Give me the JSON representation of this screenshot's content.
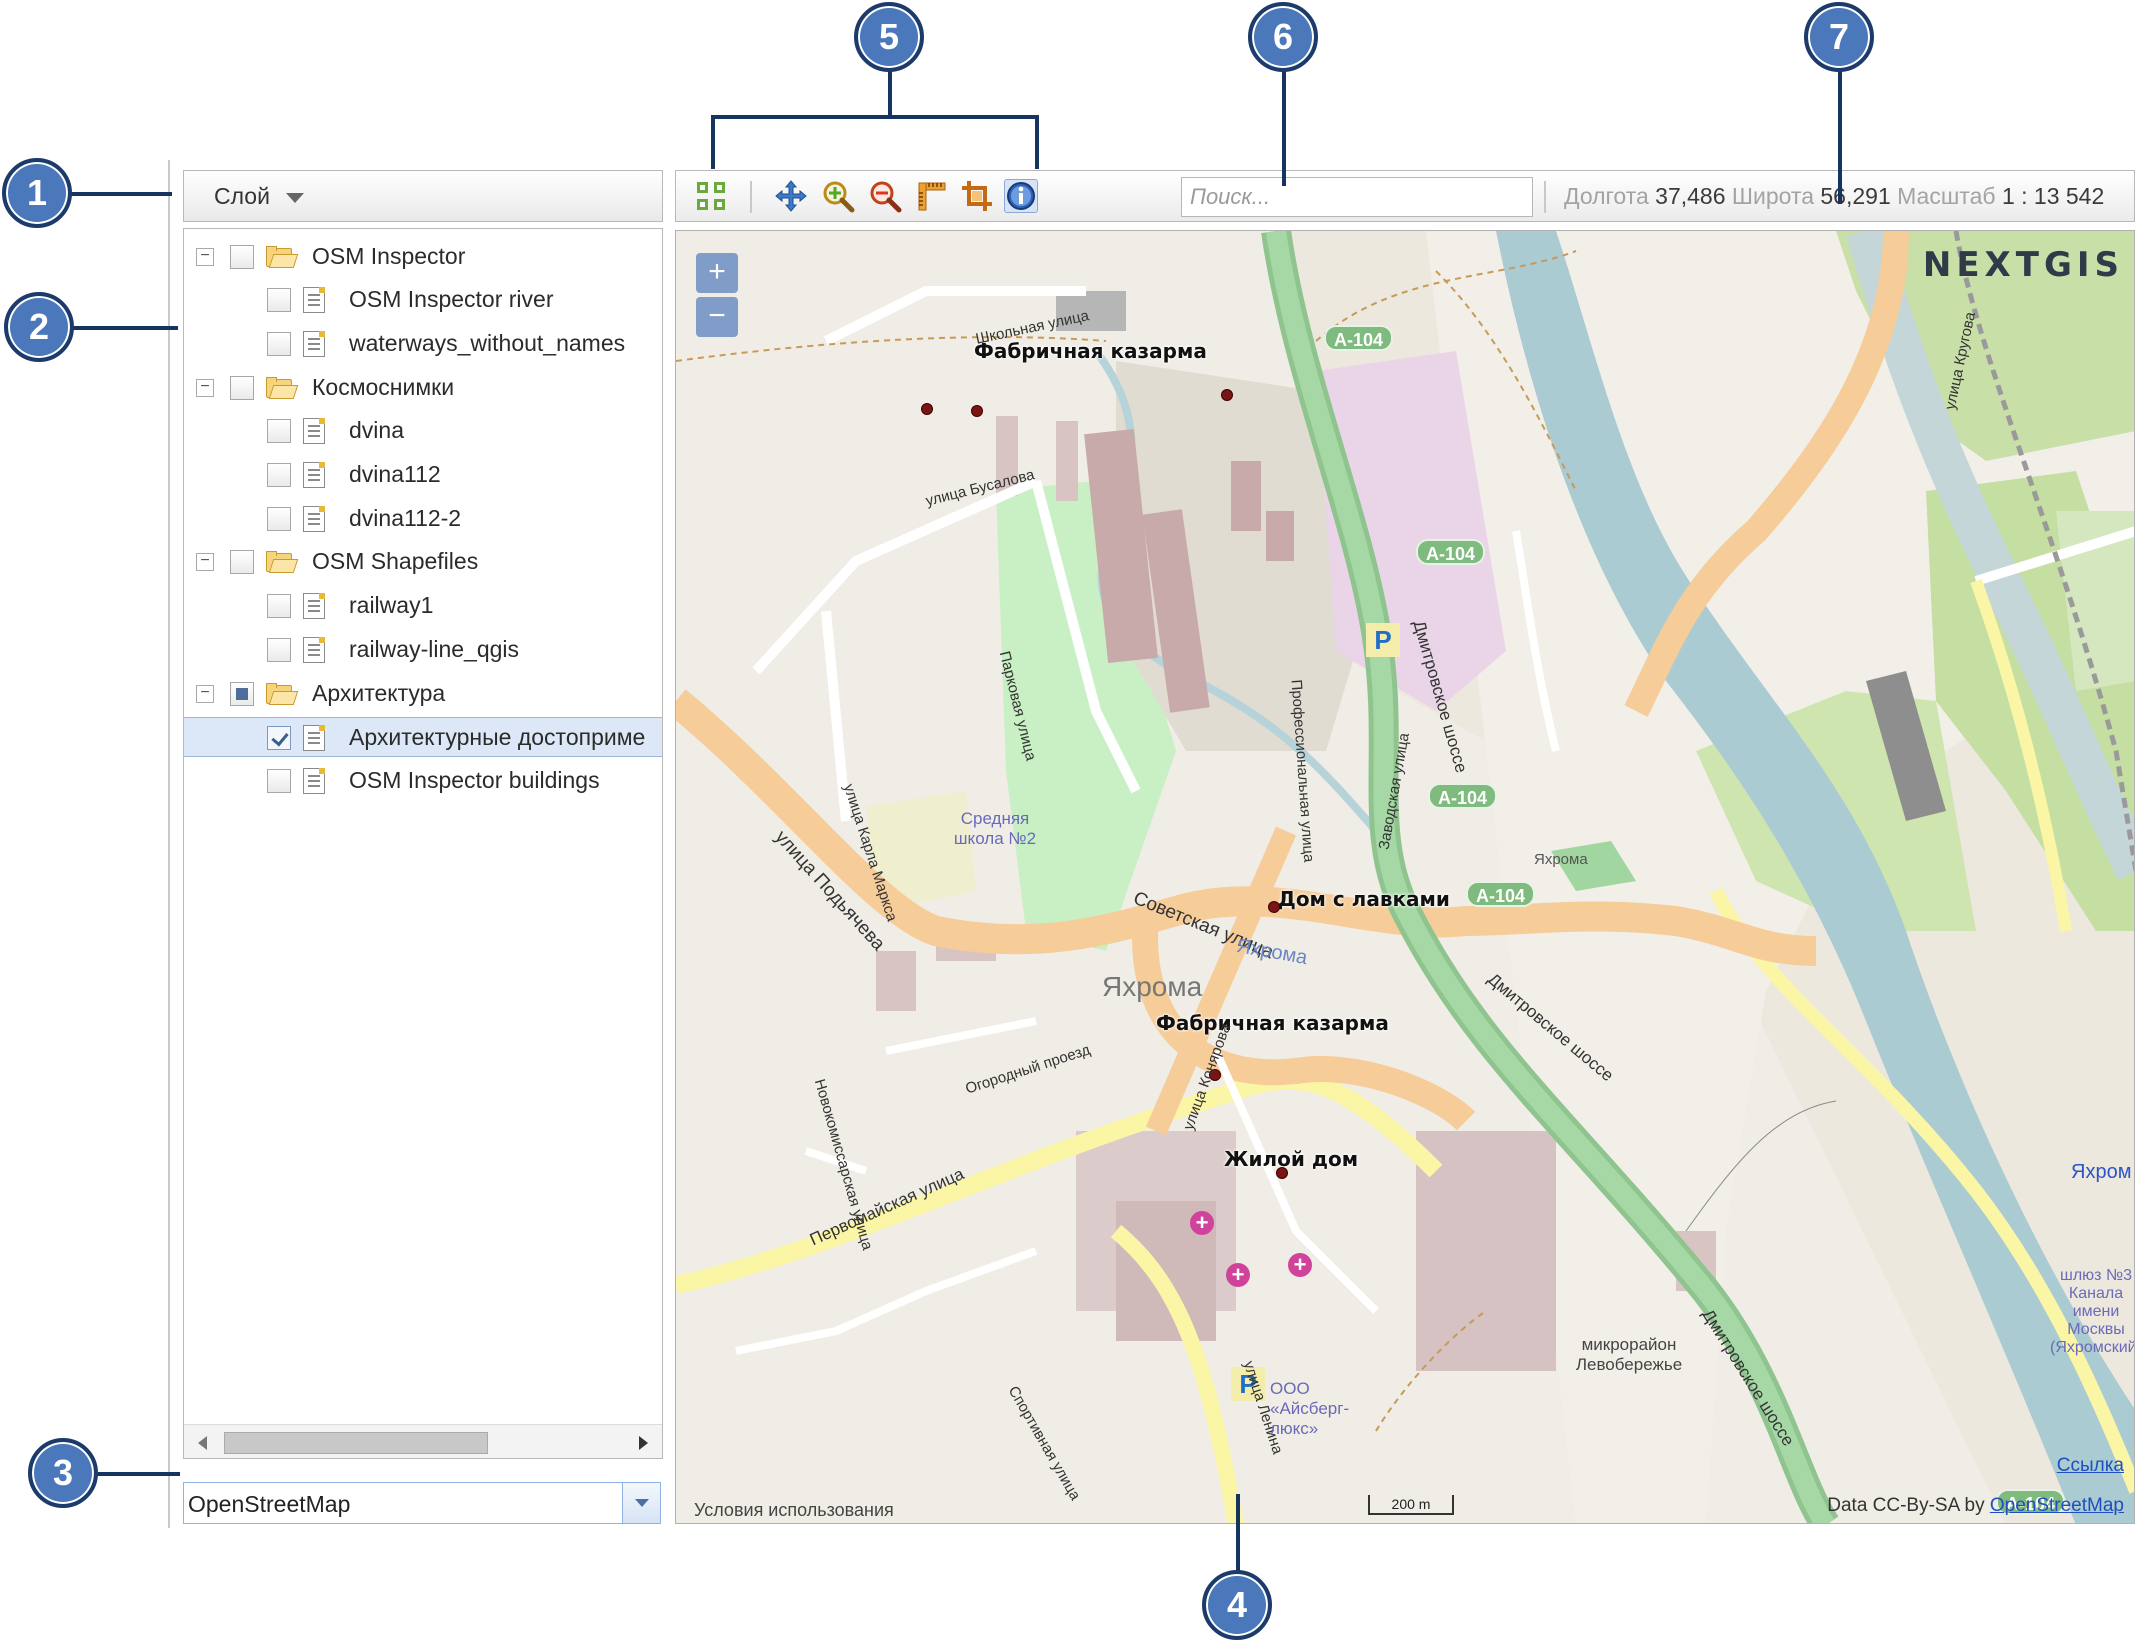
{
  "callouts": [
    "1",
    "2",
    "3",
    "4",
    "5",
    "6",
    "7"
  ],
  "layer_panel": {
    "header_label": "Слой",
    "tree": [
      {
        "label": "OSM Inspector",
        "type": "folder",
        "check": "none"
      },
      {
        "label": "OSM Inspector river",
        "type": "layer",
        "check": "none"
      },
      {
        "label": "waterways_without_names",
        "type": "layer",
        "check": "none"
      },
      {
        "label": "Космоснимки",
        "type": "folder",
        "check": "none"
      },
      {
        "label": "dvina",
        "type": "layer",
        "check": "none"
      },
      {
        "label": "dvina112",
        "type": "layer",
        "check": "none"
      },
      {
        "label": "dvina112-2",
        "type": "layer",
        "check": "none"
      },
      {
        "label": "OSM Shapefiles",
        "type": "folder",
        "check": "none"
      },
      {
        "label": "railway1",
        "type": "layer",
        "check": "none"
      },
      {
        "label": "railway-line_qgis",
        "type": "layer",
        "check": "none"
      },
      {
        "label": "Архитектура",
        "type": "folder",
        "check": "partial"
      },
      {
        "label": "Архитектурные достоприме",
        "type": "layer",
        "check": "checked",
        "selected": true
      },
      {
        "label": "OSM Inspector buildings",
        "type": "layer",
        "check": "none"
      }
    ]
  },
  "basemap": {
    "selected": "OpenStreetMap"
  },
  "toolbar": {
    "tools": [
      "extent-icon",
      "pan-icon",
      "zoom-in-icon",
      "zoom-out-icon",
      "measure-icon",
      "crop-icon",
      "identify-icon"
    ],
    "search_placeholder": "Поиск...",
    "longitude_label": "Долгота",
    "longitude_value": "37,486",
    "latitude_label": "Широта",
    "latitude_value": "56,291",
    "scale_label": "Масштаб",
    "scale_value": "1 : 13 542"
  },
  "map": {
    "zoom_in": "+",
    "zoom_out": "−",
    "logo": "NEXTGIS",
    "terms": "Условия использования",
    "scale_bar": "200 m",
    "ref_link": "Ссылка",
    "attribution_prefix": "Data CC-By-SA by",
    "attribution_link": "OpenStreetMap",
    "poi_labels": [
      "Фабричная казарма",
      "Дом с лавками",
      "Фабричная казарма",
      "Жилой дом"
    ],
    "place_label": "Яхрома",
    "road_shields": [
      "А-104",
      "А-104",
      "А-104",
      "А-104",
      "А-104"
    ],
    "road_labels": [
      "Школьная улица",
      "улица Бусалова",
      "Парковая улица",
      "улица Карла Маркса",
      "улица Подьячева",
      "Советская улица",
      "Профессиональная улица",
      "Заводская улица",
      "Дмитровское шоссе",
      "Дмитровское шоссе",
      "Дмитровское шоссе",
      "Огородный проезд",
      "Первомайская улица",
      "улица Конярова",
      "Новокомиссарская улица",
      "улица Ленина",
      "Спортивная улица",
      "улица Кругова"
    ],
    "area_labels": [
      "Средняя школа №2",
      "Яхрома",
      "Яхрома",
      "микрорайон Левобережье",
      "ООО «Айсберг-люкс»",
      "шлюз №3 Канала имени Москвы (Яхромский)",
      "Яхром"
    ],
    "water_label": "Яхрома"
  }
}
